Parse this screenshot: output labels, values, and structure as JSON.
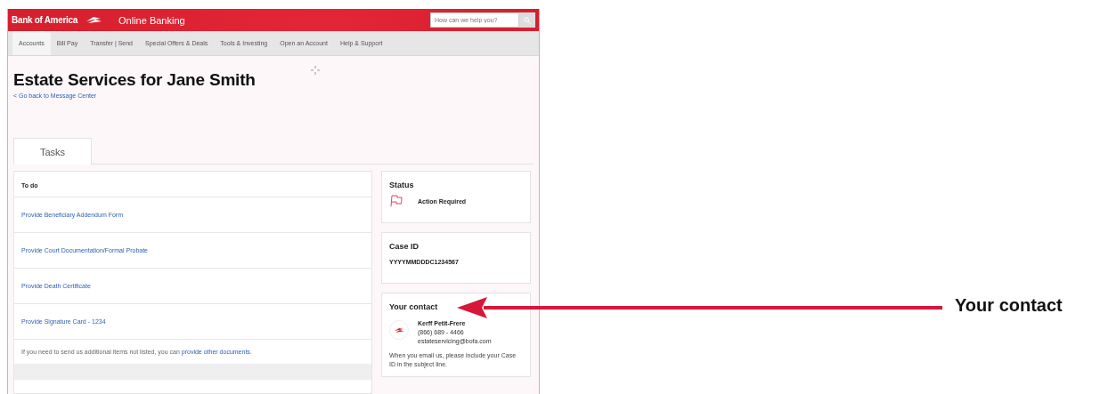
{
  "header": {
    "brand": "Bank of America",
    "product": "Online Banking",
    "search": {
      "placeholder": "How can we help you?"
    }
  },
  "nav": [
    {
      "label": "Accounts",
      "selected": true
    },
    {
      "label": "Bill Pay",
      "selected": false
    },
    {
      "label": "Transfer | Send",
      "selected": false
    },
    {
      "label": "Special Offers & Deals",
      "selected": false
    },
    {
      "label": "Tools & Investing",
      "selected": false
    },
    {
      "label": "Open an Account",
      "selected": false
    },
    {
      "label": "Help & Support",
      "selected": false
    }
  ],
  "page": {
    "title": "Estate Services for Jane Smith",
    "back_link": "< Go back to Message Center"
  },
  "tabs": [
    {
      "label": "Tasks",
      "selected": true
    }
  ],
  "todo": {
    "heading": "To do",
    "items": [
      "Provide Beneficiary Addendum Form",
      "Provide Court Documentation/Formal Probate",
      "Provide Death Certificate",
      "Provide Signature Card - 1234"
    ],
    "note": {
      "text": "If you need to send us additional items not listed, you can",
      "link": "provide other documents",
      "suffix": "."
    }
  },
  "status": {
    "heading": "Status",
    "value": "Action Required"
  },
  "case": {
    "heading": "Case ID",
    "value": "YYYYMMDDDC1234567"
  },
  "contact": {
    "heading": "Your contact",
    "name": "Kerff Petit-Frere",
    "phone": "(866) 689 - 4466",
    "email": "estateservicing@bofa.com",
    "note": "When you email us, please include your Case ID in the subject line."
  },
  "callout": {
    "label": "Your contact"
  }
}
